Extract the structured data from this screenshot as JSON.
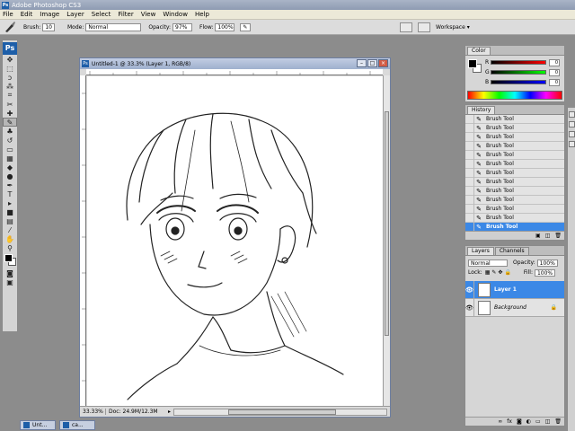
{
  "titlebar": {
    "title": "Adobe Photoshop CS3",
    "icon_label": "Ps"
  },
  "menu": [
    "File",
    "Edit",
    "Image",
    "Layer",
    "Select",
    "Filter",
    "View",
    "Window",
    "Help"
  ],
  "options": {
    "brush_label": "Brush:",
    "brush_size": "10",
    "mode_label": "Mode:",
    "mode_value": "Normal",
    "opacity_label": "Opacity:",
    "opacity_value": "97%",
    "flow_label": "Flow:",
    "flow_value": "100%",
    "workspace_label": "Workspace"
  },
  "toolbox": {
    "logo": "Ps"
  },
  "document": {
    "title": "Untitled-1 @ 33.3% (Layer 1, RGB/8)",
    "zoom": "33.33%",
    "doc_info": "Doc: 24.9M/12.3M"
  },
  "color_panel": {
    "tab": "Color",
    "sliders": [
      {
        "label": "R",
        "value": "0"
      },
      {
        "label": "G",
        "value": "0"
      },
      {
        "label": "B",
        "value": "0"
      }
    ]
  },
  "history_panel": {
    "tab": "History",
    "items": [
      "Brush Tool",
      "Brush Tool",
      "Brush Tool",
      "Brush Tool",
      "Brush Tool",
      "Brush Tool",
      "Brush Tool",
      "Brush Tool",
      "Brush Tool",
      "Brush Tool",
      "Brush Tool",
      "Brush Tool",
      "Brush Tool"
    ],
    "selected_index": 12
  },
  "layers_panel": {
    "tabs": [
      "Layers",
      "Channels"
    ],
    "blend_mode": "Normal",
    "opacity_label": "Opacity:",
    "opacity_value": "100%",
    "lock_label": "Lock:",
    "fill_label": "Fill:",
    "fill_value": "100%",
    "layers": [
      {
        "name": "Layer 1",
        "selected": true
      },
      {
        "name": "Background",
        "selected": false
      }
    ]
  },
  "taskbar": {
    "items": [
      "Unt...",
      "ca..."
    ]
  }
}
